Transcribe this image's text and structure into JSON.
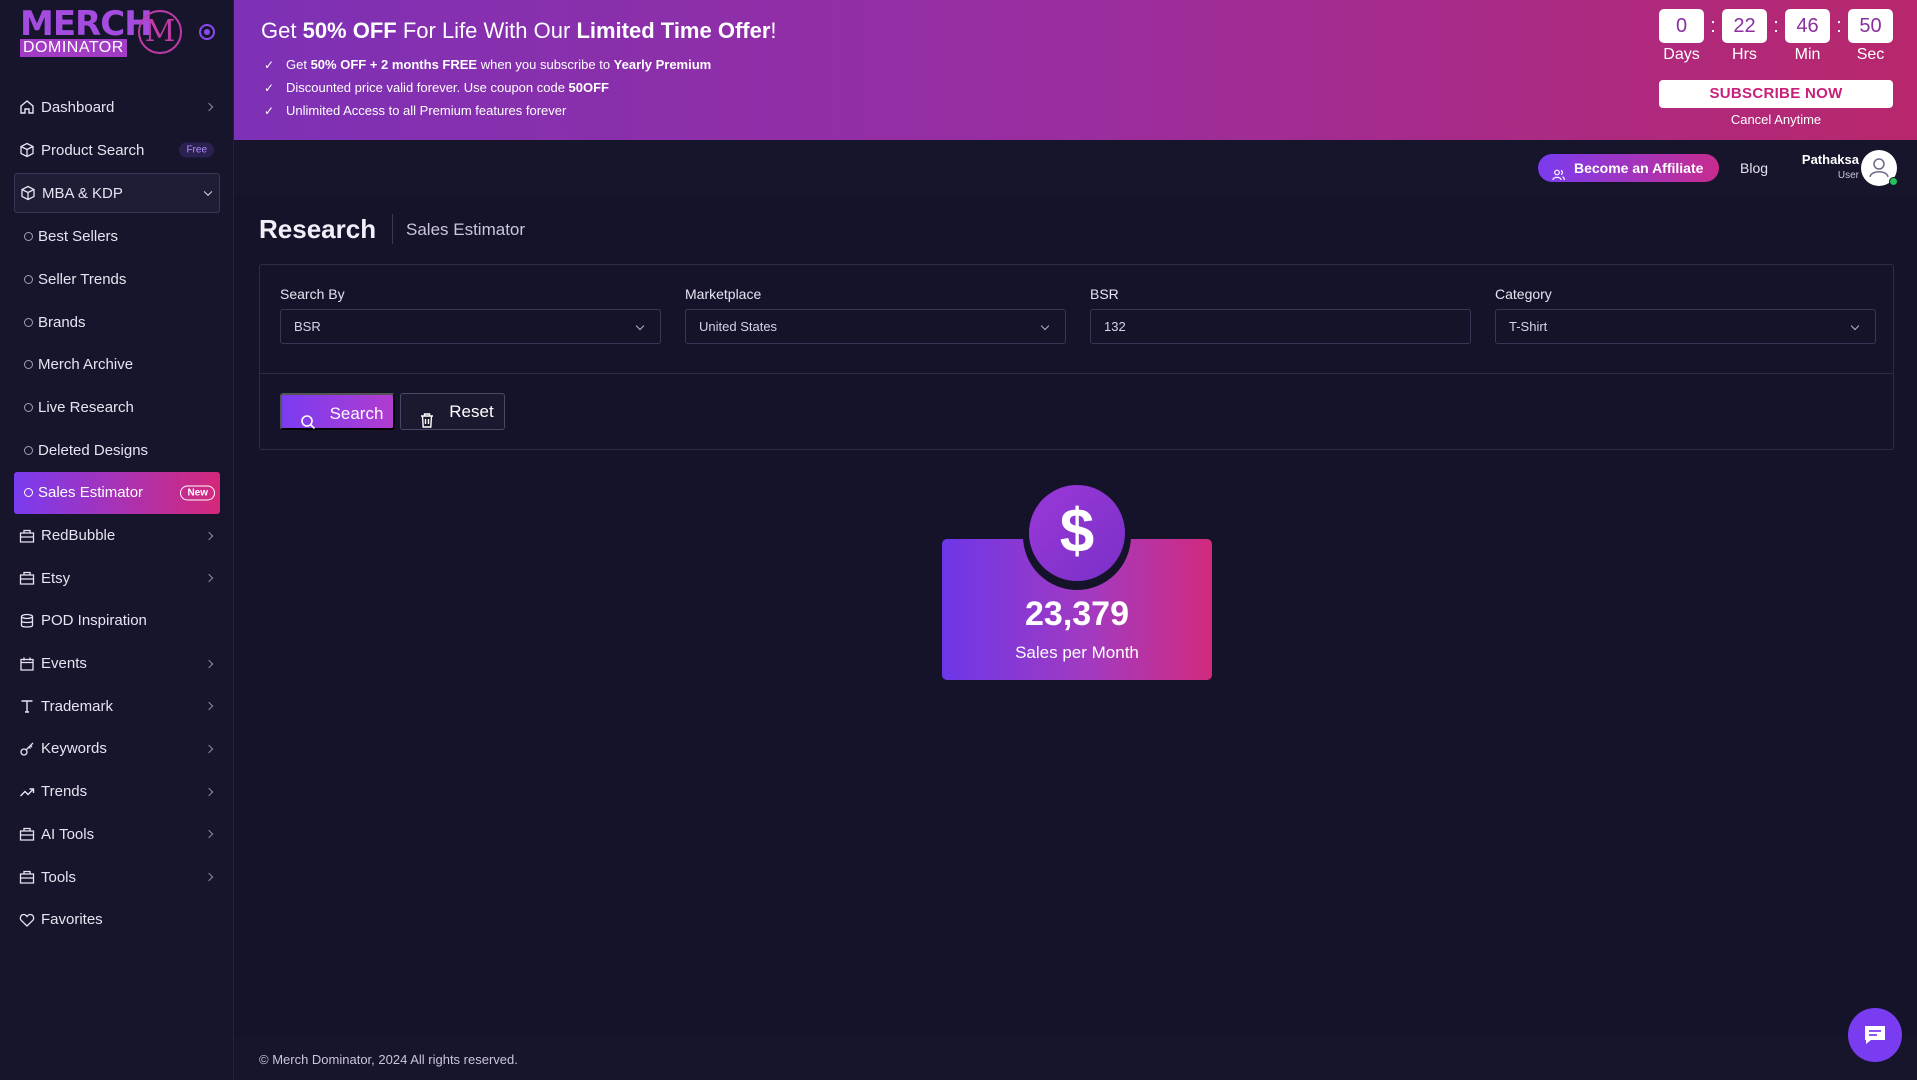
{
  "brand": {
    "line1": "MERCH",
    "line2": "DOMINATOR",
    "mark": "M"
  },
  "sidebar": {
    "items": [
      {
        "label": "Dashboard",
        "icon": "home-icon"
      },
      {
        "label": "Product Search",
        "badge": "Free",
        "icon": "box-icon"
      },
      {
        "label": "MBA & KDP",
        "icon": "box-icon"
      },
      {
        "label": "Best Sellers"
      },
      {
        "label": "Seller Trends"
      },
      {
        "label": "Brands"
      },
      {
        "label": "Merch Archive"
      },
      {
        "label": "Live Research"
      },
      {
        "label": "Deleted Designs"
      },
      {
        "label": "Sales Estimator",
        "badge": "New"
      },
      {
        "label": "RedBubble",
        "icon": "shop-icon"
      },
      {
        "label": "Etsy",
        "icon": "shop-icon"
      },
      {
        "label": "POD Inspiration",
        "icon": "database-icon"
      },
      {
        "label": "Events",
        "icon": "calendar-icon"
      },
      {
        "label": "Trademark",
        "icon": "text-icon"
      },
      {
        "label": "Keywords",
        "icon": "key-icon"
      },
      {
        "label": "Trends",
        "icon": "trend-icon"
      },
      {
        "label": "AI Tools",
        "icon": "shop-icon"
      },
      {
        "label": "Tools",
        "icon": "shop-icon"
      },
      {
        "label": "Favorites",
        "icon": "heart-icon"
      }
    ]
  },
  "promo": {
    "title_pre": "Get ",
    "title_b1": "50% OFF",
    "title_mid": " For Life With Our ",
    "title_b2": "Limited Time Offer",
    "title_end": "!",
    "bullet1_pre": "Get ",
    "bullet1_b1": "50% OFF + 2 months FREE",
    "bullet1_mid": " when you subscribe to ",
    "bullet1_b2": "Yearly Premium",
    "bullet2_pre": "Discounted price valid forever. Use coupon code ",
    "bullet2_b": "50OFF",
    "bullet3": "Unlimited Access to all Premium features forever",
    "check": "✓",
    "countdown": {
      "days": "0",
      "days_label": "Days",
      "hrs": "22",
      "hrs_label": "Hrs",
      "min": "46",
      "min_label": "Min",
      "sec": "50",
      "sec_label": "Sec",
      "sep": ":"
    },
    "subscribe_label": "SUBSCRIBE NOW",
    "cancel_label": "Cancel Anytime"
  },
  "topbar": {
    "affiliate_label": "Become an Affiliate",
    "blog_label": "Blog",
    "user_name": "Pathaksa",
    "user_role": "User"
  },
  "page": {
    "title": "Research",
    "subtitle": "Sales Estimator"
  },
  "form": {
    "search_by": {
      "label": "Search By",
      "value": "BSR"
    },
    "marketplace": {
      "label": "Marketplace",
      "value": "United States"
    },
    "bsr": {
      "label": "BSR",
      "value": "132"
    },
    "category": {
      "label": "Category",
      "value": "T-Shirt"
    },
    "search_label": "Search",
    "reset_label": "Reset"
  },
  "result": {
    "symbol": "$",
    "value": "23,379",
    "label": "Sales per Month"
  },
  "footer": {
    "text": "© Merch Dominator, 2024 All rights reserved."
  },
  "colors": {
    "accent": "#7a3cf0",
    "accent2": "#d4287a",
    "bg": "#15132a",
    "sidebar": "#17152b"
  }
}
